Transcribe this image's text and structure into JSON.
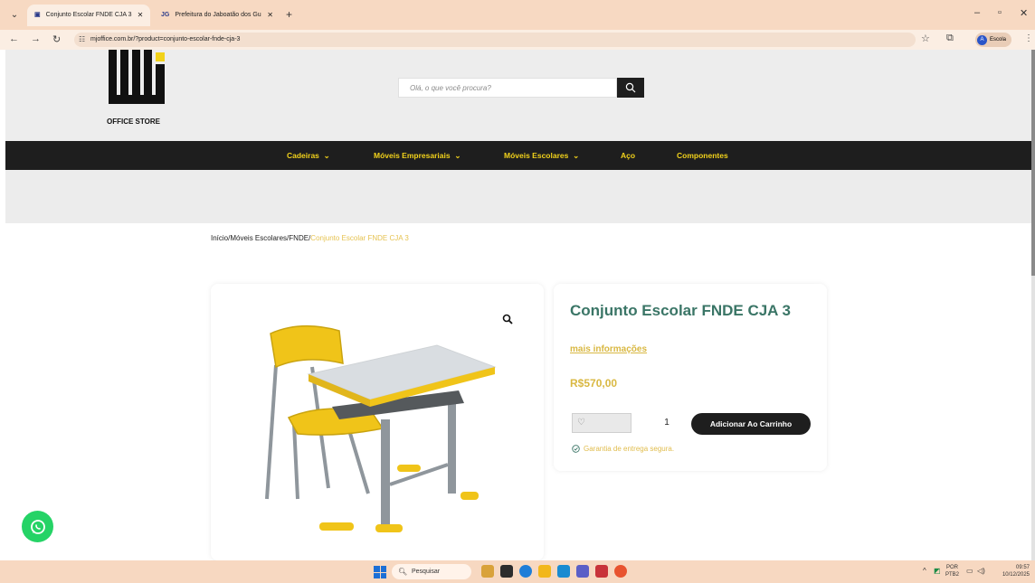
{
  "browser": {
    "tabs": [
      {
        "label": "Conjunto Escolar FNDE CJA 3",
        "active": true
      },
      {
        "label": "Prefeitura do Jaboatão dos Gu",
        "favicon": "JG",
        "active": false
      }
    ],
    "url": "mjoffice.com.br/?product=conjunto-escolar-fnde-cja-3",
    "profile_label": "Escola",
    "profile_initial": "A"
  },
  "site": {
    "logo_text": "OFFICE STORE",
    "search_placeholder": "Olá, o que você procura?",
    "nav": [
      {
        "label": "Cadeiras",
        "has_dropdown": true
      },
      {
        "label": "Móveis Empresariais",
        "has_dropdown": true
      },
      {
        "label": "Móveis Escolares",
        "has_dropdown": true
      },
      {
        "label": "Aço",
        "has_dropdown": false
      },
      {
        "label": "Componentes",
        "has_dropdown": false
      }
    ],
    "colors": {
      "accent": "#f2d21b",
      "title": "#3a7566",
      "price": "#d9b842",
      "dark": "#1e1e1e"
    }
  },
  "breadcrumb": {
    "items": [
      "Início",
      "Móveis Escolares",
      "FNDE"
    ],
    "current": "Conjunto Escolar FNDE CJA 3"
  },
  "product": {
    "title": "Conjunto Escolar FNDE CJA 3",
    "more_info": "mais informações",
    "price": "R$570,00",
    "quantity": "1",
    "add_to_cart": "Adicionar Ao Carrinho",
    "guarantee": "Garantia de entrega segura."
  },
  "taskbar": {
    "search_label": "Pesquisar",
    "lang_top": "POR",
    "lang_bottom": "PTB2",
    "time": "09:57",
    "date": "10/12/2025"
  }
}
